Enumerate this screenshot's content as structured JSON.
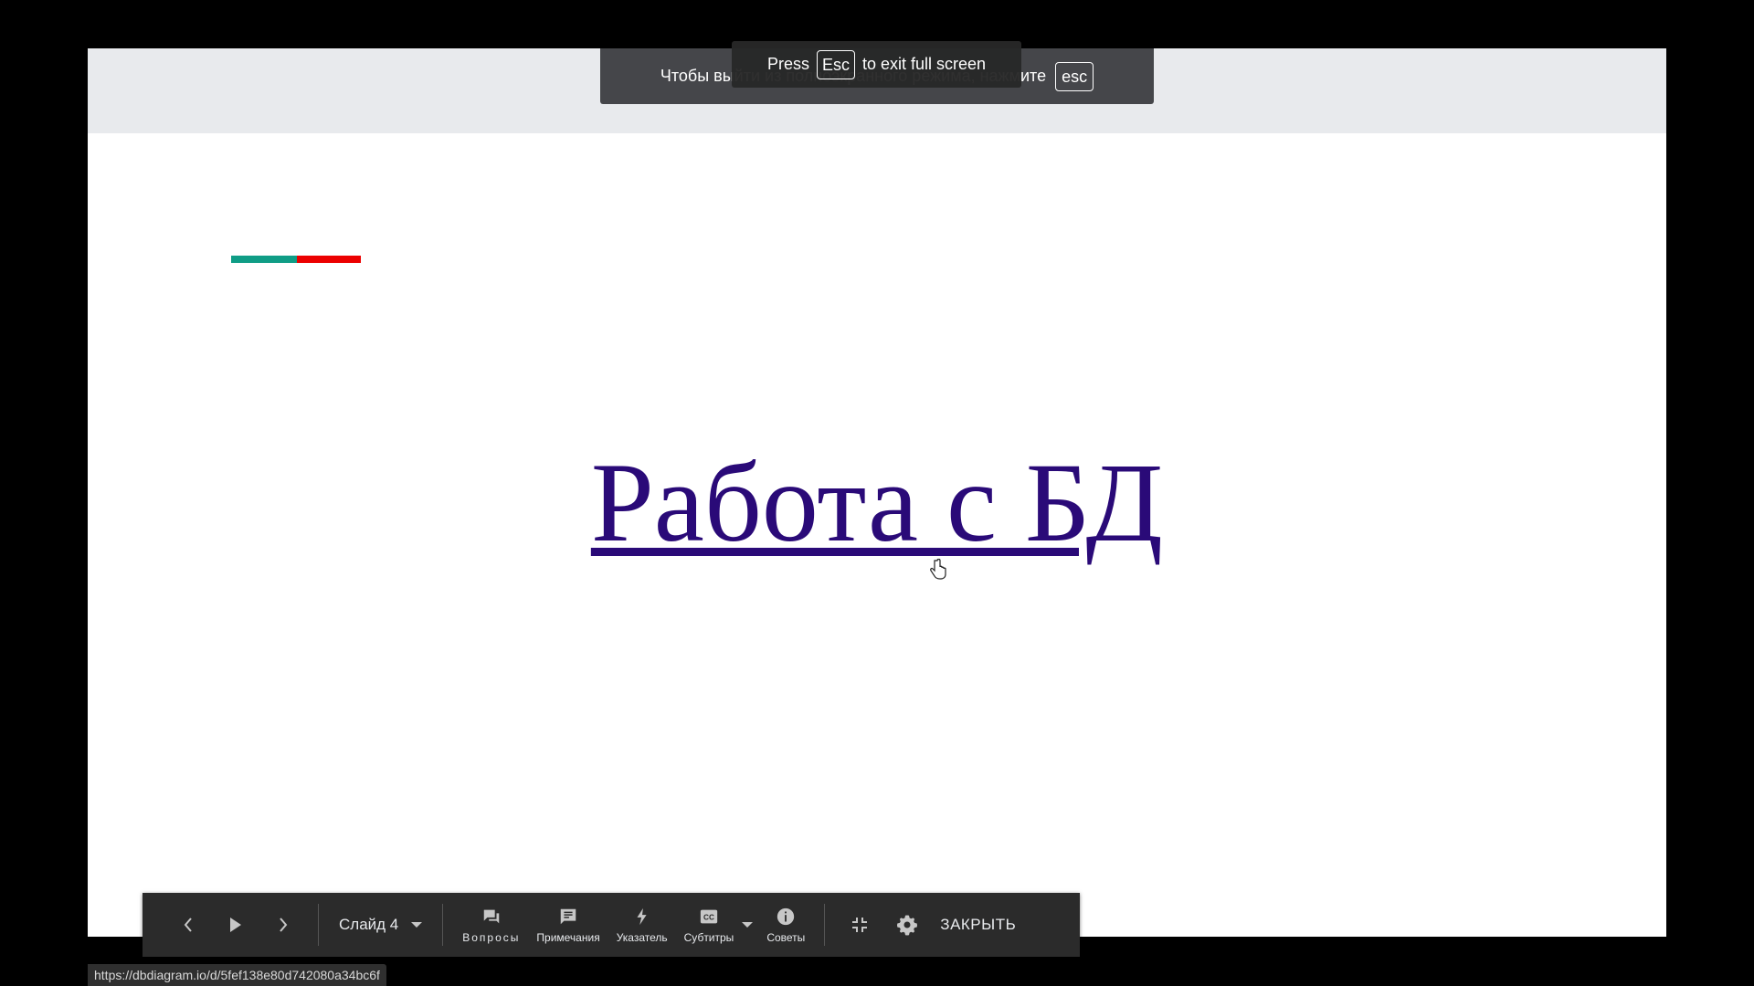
{
  "banner_ru": {
    "text": "Чтобы выйти из полноэкранного режима, нажмите",
    "key": "esc"
  },
  "banner_en": {
    "before": "Press",
    "key": "Esc",
    "after": "to exit full screen"
  },
  "slide": {
    "title": "Работа с БД"
  },
  "toolbar": {
    "slide_label": "Слайд 4",
    "tools": {
      "questions": "Вопросы",
      "notes": "Примечания",
      "pointer": "Указатель",
      "captions": "Субтитры",
      "tips": "Советы"
    },
    "close_label": "ЗАКРЫТЬ"
  },
  "status_bar": {
    "url": "https://dbdiagram.io/d/5fef138e80d742080a34bc6f"
  },
  "colors": {
    "title": "#2a0a78",
    "accent_teal": "#0f9d86",
    "accent_red": "#ec0000",
    "toolbar_bg": "#2b2b2b"
  }
}
